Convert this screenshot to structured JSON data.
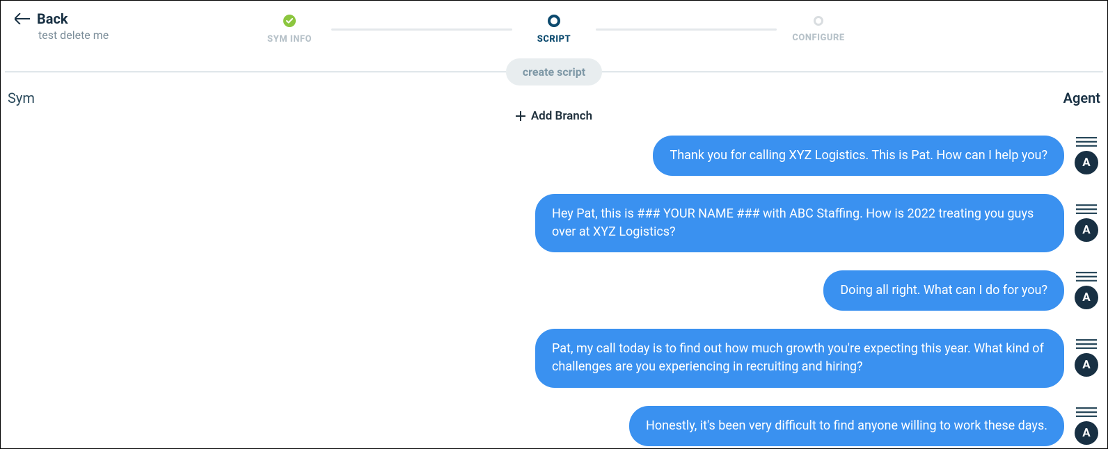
{
  "header": {
    "back_label": "Back",
    "subtitle": "test delete me"
  },
  "stepper": {
    "steps": [
      {
        "label": "SYM INFO",
        "state": "done"
      },
      {
        "label": "SCRIPT",
        "state": "active"
      },
      {
        "label": "CONFIGURE",
        "state": "inactive"
      }
    ]
  },
  "divider": {
    "pill_label": "create script"
  },
  "side_labels": {
    "left": "Sym",
    "right": "Agent"
  },
  "add_branch_label": "Add Branch",
  "avatar_letter": "A",
  "messages": [
    {
      "text": "Thank you for calling XYZ Logistics. This is Pat. How can I help you?"
    },
    {
      "text": "Hey Pat, this is ### YOUR NAME ### with ABC Staffing. How is 2022 treating you guys over at XYZ Logistics?"
    },
    {
      "text": "Doing all right. What can I do for you?"
    },
    {
      "text": "Pat, my call today is to find out how much growth you're expecting this year. What kind of challenges are you experiencing in recruiting and hiring?"
    },
    {
      "text": "Honestly, it's been very difficult to find anyone willing to work these days."
    }
  ]
}
